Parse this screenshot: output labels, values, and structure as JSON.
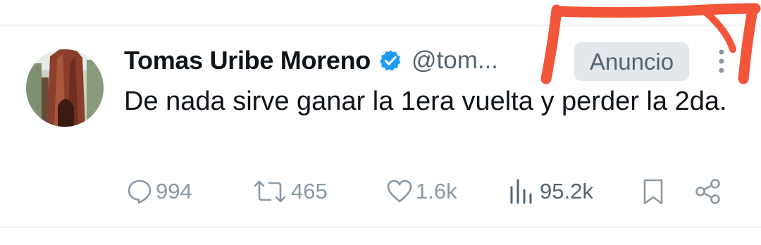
{
  "tweet": {
    "author_name": "Tomas Uribe Moreno",
    "handle": "@tom...",
    "badge": "Anuncio",
    "text": "De nada sirve ganar la 1era vuelta y perder la 2da.",
    "verified": true
  },
  "actions": {
    "replies": "994",
    "retweets": "465",
    "likes": "1.6k",
    "views": "95.2k"
  },
  "icons": {
    "reply": "speech-bubble-icon",
    "retweet": "retweet-arrows-icon",
    "like": "heart-icon",
    "views": "bar-chart-icon",
    "bookmark": "bookmark-icon",
    "share": "share-nodes-icon",
    "more": "vertical-dots-icon"
  },
  "colors": {
    "text": "#0f1419",
    "secondary": "#536471",
    "verified_blue": "#1d9bf0",
    "badge_bg": "#e3e8ec",
    "annotation_red": "#f2553a"
  }
}
